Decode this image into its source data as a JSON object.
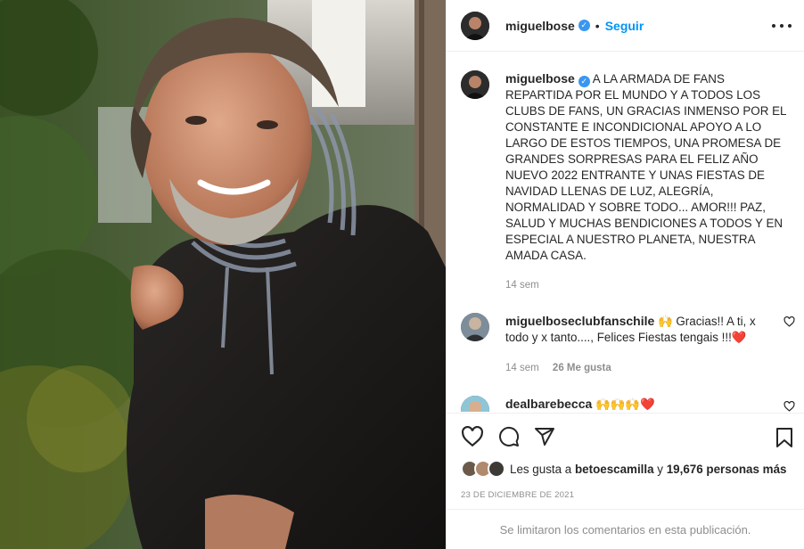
{
  "post": {
    "author": "miguelbose",
    "follow_label": "Seguir",
    "dot": "•",
    "caption": "A LA ARMADA DE FANS REPARTIDA POR EL MUNDO Y A TODOS LOS CLUBS DE FANS, UN GRACIAS INMENSO POR EL CONSTANTE E INCONDICIONAL APOYO A LO LARGO DE ESTOS TIEMPOS, UNA PROMESA DE GRANDES SORPRESAS PARA EL FELIZ AÑO NUEVO 2022 ENTRANTE Y UNAS FIESTAS DE NAVIDAD LLENAS DE LUZ, ALEGRÍA, NORMALIDAD Y SOBRE TODO... AMOR!!! PAZ, SALUD Y MUCHAS BENDICIONES A TODOS Y EN ESPECIAL A NUESTRO PLANETA, NUESTRA AMADA CASA.",
    "caption_age": "14 sem",
    "verified_mark": "✓"
  },
  "comments": [
    {
      "user": "miguelboseclubfanschile",
      "text": "🙌 Gracias!! A ti, x todo y x tanto...., Felices Fiestas tengais !!!❤️",
      "age": "14 sem",
      "likes": "26 Me gusta"
    },
    {
      "user": "dealbarebecca",
      "text": "🙌🙌🙌❤️",
      "age": "",
      "likes": ""
    }
  ],
  "likes_line": {
    "prefix": "Les gusta a",
    "user": "betoescamilla",
    "conj": "y",
    "others": "19,676 personas más"
  },
  "date": "23 DE DICIEMBRE DE 2021",
  "comments_limited": "Se limitaron los comentarios en esta publicación.",
  "colors": {
    "accent": "#0095f6",
    "heart": "#ed4956",
    "muted": "#8e8e8e"
  }
}
